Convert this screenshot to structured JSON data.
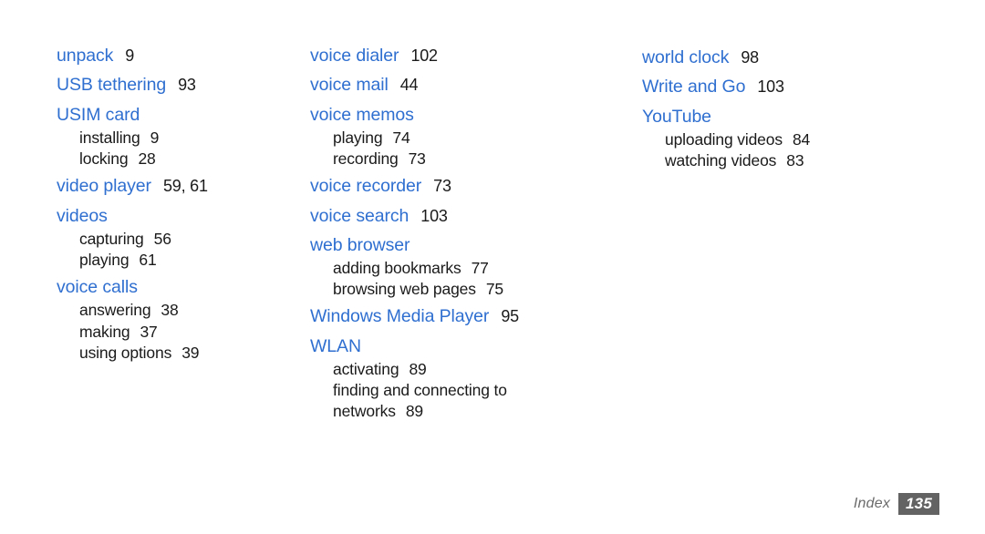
{
  "document": {
    "type": "index-page",
    "footer": {
      "label": "Index",
      "page_number": "135"
    },
    "colors": {
      "term": "#2f6fd0",
      "body": "#1a1a1a",
      "background": "#ffffff",
      "badge_background": "#636363",
      "footer_label": "#6b6b6b"
    }
  },
  "columns": [
    {
      "entries": [
        {
          "term": "unpack",
          "pages": "9",
          "subs": []
        },
        {
          "term": "USB tethering",
          "pages": "93",
          "subs": []
        },
        {
          "term": "USIM card",
          "pages": "",
          "subs": [
            {
              "label": "installing",
              "pages": "9"
            },
            {
              "label": "locking",
              "pages": "28"
            }
          ]
        },
        {
          "term": "video player",
          "pages": "59, 61",
          "subs": []
        },
        {
          "term": "videos",
          "pages": "",
          "subs": [
            {
              "label": "capturing",
              "pages": "56"
            },
            {
              "label": "playing",
              "pages": "61"
            }
          ]
        },
        {
          "term": "voice calls",
          "pages": "",
          "subs": [
            {
              "label": "answering",
              "pages": "38"
            },
            {
              "label": "making",
              "pages": "37"
            },
            {
              "label": "using options",
              "pages": "39"
            }
          ]
        }
      ]
    },
    {
      "entries": [
        {
          "term": "voice dialer",
          "pages": "102",
          "subs": []
        },
        {
          "term": "voice mail",
          "pages": "44",
          "subs": []
        },
        {
          "term": "voice memos",
          "pages": "",
          "subs": [
            {
              "label": "playing",
              "pages": "74"
            },
            {
              "label": "recording",
              "pages": "73"
            }
          ]
        },
        {
          "term": "voice recorder",
          "pages": "73",
          "subs": []
        },
        {
          "term": "voice search",
          "pages": "103",
          "subs": []
        },
        {
          "term": "web browser",
          "pages": "",
          "subs": [
            {
              "label": "adding bookmarks",
              "pages": "77"
            },
            {
              "label": "browsing web pages",
              "pages": "75"
            }
          ]
        },
        {
          "term": "Windows Media Player",
          "pages": "95",
          "subs": []
        },
        {
          "term": "WLAN",
          "pages": "",
          "subs": [
            {
              "label": "activating",
              "pages": "89"
            },
            {
              "label": "finding and connecting to networks",
              "pages": "89"
            }
          ]
        }
      ]
    },
    {
      "entries": [
        {
          "term": "world clock",
          "pages": "98",
          "subs": []
        },
        {
          "term": "Write and Go",
          "pages": "103",
          "subs": []
        },
        {
          "term": "YouTube",
          "pages": "",
          "subs": [
            {
              "label": "uploading videos",
              "pages": "84"
            },
            {
              "label": "watching videos",
              "pages": "83"
            }
          ]
        }
      ]
    }
  ]
}
